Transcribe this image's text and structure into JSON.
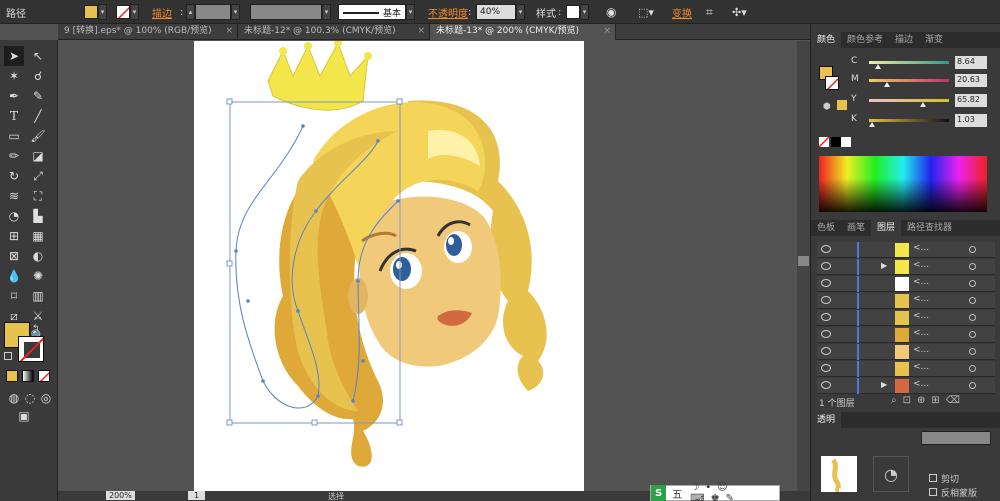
{
  "control_bar": {
    "label": "路径",
    "stroke_label": "描边",
    "stroke_style": "基本",
    "opacity_label": "不透明度",
    "opacity_value": "40%",
    "style_label": "样式",
    "transform_label": "变换",
    "fill_color": "#e8c24e"
  },
  "tabs": [
    {
      "label": "9 [转换].eps* @ 100% (RGB/预览)",
      "active": false
    },
    {
      "label": "未标题-12* @ 100.3% (CMYK/预览)",
      "active": false
    },
    {
      "label": "未标题-13* @ 200% (CMYK/预览)",
      "active": true
    }
  ],
  "color_panel": {
    "tabs": [
      "颜色",
      "颜色参考",
      "描边",
      "渐变"
    ],
    "channels": [
      {
        "name": "C",
        "value": "8.64",
        "track": "#2a9a8a",
        "pos": 0.09
      },
      {
        "name": "M",
        "value": "20.63",
        "track": "#c03070",
        "pos": 0.21
      },
      {
        "name": "Y",
        "value": "65.82",
        "track": "#d0c020",
        "pos": 0.66
      },
      {
        "name": "K",
        "value": "1.03",
        "track": "#888888",
        "pos": 0.01
      }
    ]
  },
  "layers_panel": {
    "tabs": [
      "色板",
      "画笔",
      "图层",
      "路径查找器"
    ],
    "rows": [
      {
        "name": "<...",
        "expand": false
      },
      {
        "name": "<...",
        "expand": true
      },
      {
        "name": "<...",
        "expand": false
      },
      {
        "name": "<...",
        "expand": false
      },
      {
        "name": "<...",
        "expand": false
      },
      {
        "name": "<...",
        "expand": false
      },
      {
        "name": "<...",
        "expand": false
      },
      {
        "name": "<...",
        "expand": false
      },
      {
        "name": "<...",
        "expand": true
      }
    ],
    "footer": "1 个图层"
  },
  "second_panel": {
    "tab": "透明",
    "checkbox1": "剪切",
    "checkbox2": "反相蒙版"
  },
  "status_bar": {
    "zoom": "200%",
    "page": "1",
    "mode": "选择"
  },
  "ime": {
    "label": "五"
  }
}
